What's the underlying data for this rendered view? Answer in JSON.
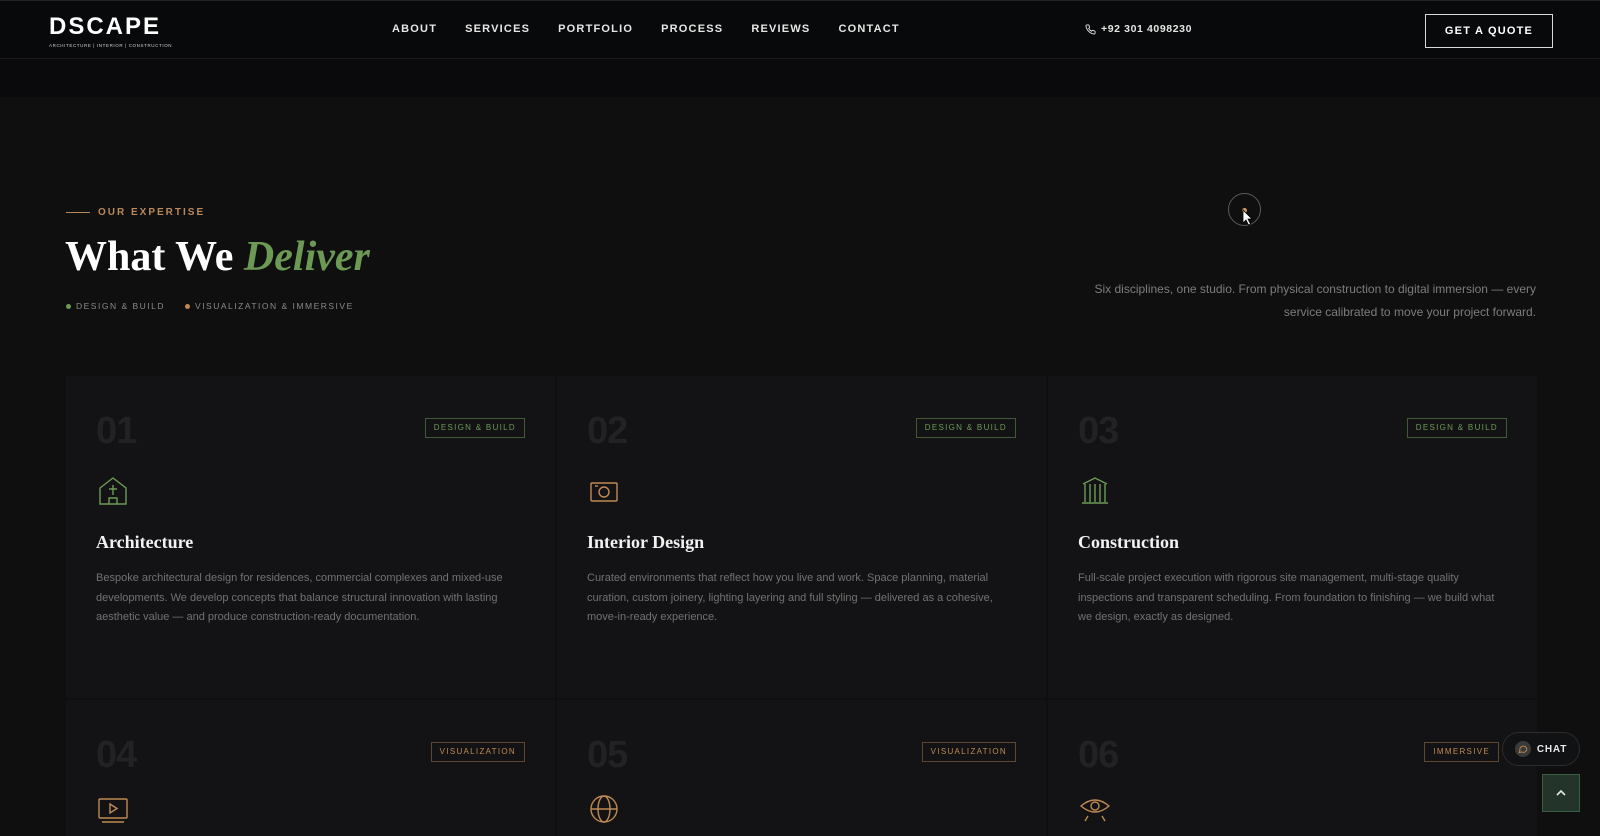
{
  "header": {
    "logo_word": "DSCAPE",
    "logo_sub": "ARCHITECTURE | INTERIOR | CONSTRUCTION",
    "nav": [
      "ABOUT",
      "SERVICES",
      "PORTFOLIO",
      "PROCESS",
      "REVIEWS",
      "CONTACT"
    ],
    "phone": "+92 301 4098230",
    "cta": "GET A QUOTE"
  },
  "intro": {
    "eyebrow": "OUR EXPERTISE",
    "title_main": "What We",
    "title_accent": "Deliver",
    "tags": [
      {
        "label": "DESIGN & BUILD",
        "color": "#6c9a55"
      },
      {
        "label": "VISUALIZATION & IMMERSIVE",
        "color": "#c08a52"
      }
    ],
    "description": "Six disciplines, one studio. From physical construction to digital immersion — every service calibrated to move your project forward."
  },
  "services": [
    {
      "num": "01",
      "badge": "DESIGN & BUILD",
      "icon": "house-icon",
      "title": "Architecture",
      "desc": "Bespoke architectural design for residences, commercial complexes and mixed-use developments. We develop concepts that balance structural innovation with lasting aesthetic value — and produce construction-ready documentation."
    },
    {
      "num": "02",
      "badge": "DESIGN & BUILD",
      "icon": "camera-icon",
      "title": "Interior Design",
      "desc": "Curated environments that reflect how you live and work. Space planning, material curation, custom joinery, lighting layering and full styling — delivered as a cohesive, move-in-ready experience."
    },
    {
      "num": "03",
      "badge": "DESIGN & BUILD",
      "icon": "columns-icon",
      "title": "Construction",
      "desc": "Full-scale project execution with rigorous site management, multi-stage quality inspections and transparent scheduling. From foundation to finishing — we build what we design, exactly as designed."
    },
    {
      "num": "04",
      "badge": "VISUALIZATION",
      "icon": "video-play-icon",
      "title": "",
      "desc": ""
    },
    {
      "num": "05",
      "badge": "VISUALIZATION",
      "icon": "globe-icon",
      "title": "",
      "desc": ""
    },
    {
      "num": "06",
      "badge": "IMMERSIVE",
      "icon": "eye-icon",
      "title": "",
      "desc": ""
    }
  ],
  "colors": {
    "green": "#6c9a55",
    "orange": "#c08a52"
  },
  "chat": {
    "label": "CHAT"
  }
}
